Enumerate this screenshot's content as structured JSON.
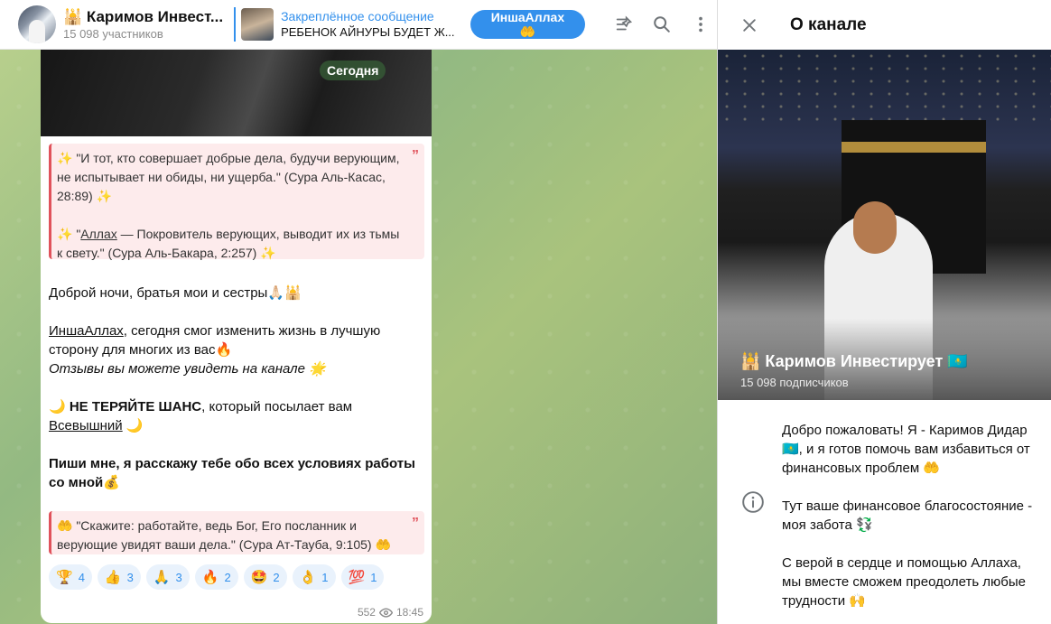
{
  "header": {
    "channel_name": "🕌 Каримов Инвест...",
    "members": "15 098 участников",
    "pinned_title": "Закреплённое сообщение",
    "pinned_text": "РЕБЕНОК АЙНУРЫ БУДЕТ Ж...",
    "pinned_button": "ИншаАллах 🤲"
  },
  "chat": {
    "date_chip": "Сегодня",
    "quote1_line1": "✨ \"И тот, кто совершает добрые дела, будучи верующим, не испытывает ни обиды, ни ущерба.\" (Сура Аль-Касас, 28:89) ✨",
    "quote1_line2_prefix": "✨ \"",
    "quote1_line2_link": "Аллах",
    "quote1_line2_rest": " — Покровитель верующих, выводит их из тьмы к свету.\" (Сура Аль-Бакара, 2:257) ✨",
    "greeting": "Доброй ночи, братья мои и сестры🙏🏻🕌",
    "p2_link": "ИншаАллах",
    "p2_rest": ", сегодня смог изменить жизнь в лучшую сторону для многих из вас🔥",
    "p2_italic": "Отзывы вы можете увидеть на канале 🌟",
    "p3_bold": "🌙 НЕ ТЕРЯЙТЕ ШАНС",
    "p3_rest": ", который посылает вам",
    "p3_link": "Всевышний",
    "p3_end": " 🌙",
    "p4": "Пиши мне, я расскажу тебе обо всех условиях работы со мной💰",
    "quote2": "🤲 \"Скажите: работайте, ведь Бог, Его посланник и верующие увидят ваши дела.\" (Сура Ат-Тауба, 9:105) 🤲",
    "reactions": [
      {
        "emoji": "🏆",
        "count": "4"
      },
      {
        "emoji": "👍",
        "count": "3"
      },
      {
        "emoji": "🙏",
        "count": "3"
      },
      {
        "emoji": "🔥",
        "count": "2"
      },
      {
        "emoji": "🤩",
        "count": "2"
      },
      {
        "emoji": "👌",
        "count": "1"
      },
      {
        "emoji": "💯",
        "count": "1"
      }
    ],
    "views": "552",
    "time": "18:45"
  },
  "panel": {
    "title": "О канале",
    "channel_name": "🕌 Каримов Инвестирует 🇰🇿",
    "subscribers": "15 098 подписчиков",
    "about_1": "Добро пожаловать! Я - Каримов Дидар 🇰🇿, и я готов помочь вам избавиться от финансовых проблем 🤲",
    "about_2": "Тут ваше финансовое благосостояние - моя забота 💱",
    "about_3": "С верой в сердце и помощью Аллаха, мы вместе сможем преодолеть любые трудности 🙌"
  },
  "colors": {
    "accent": "#3390ec",
    "quote_border": "#e0525b",
    "quote_bg": "#fdebec"
  }
}
